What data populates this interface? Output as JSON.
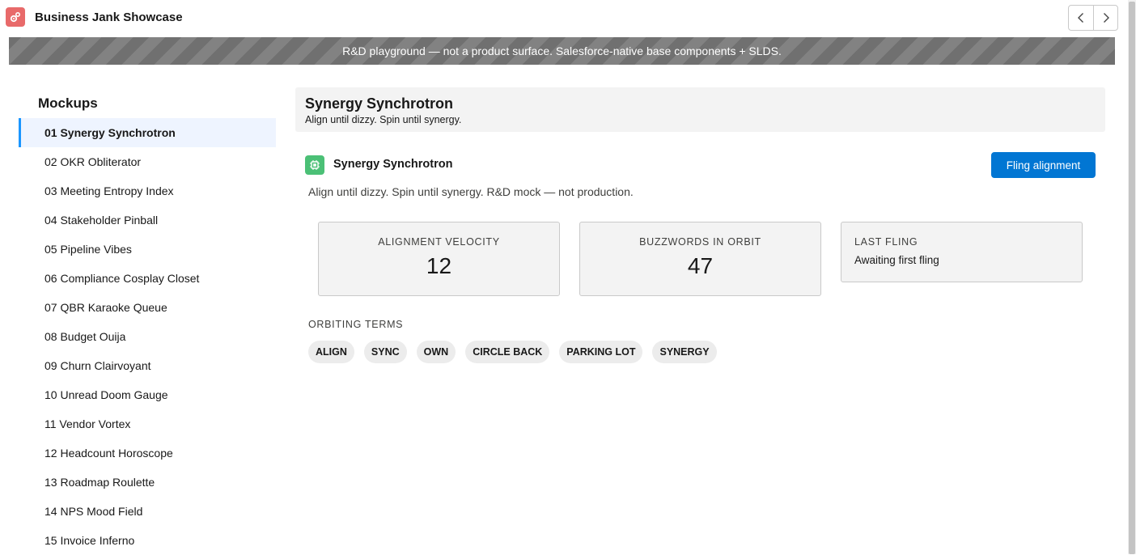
{
  "app": {
    "title": "Business Jank Showcase",
    "icon": "gears-icon",
    "accent": "#e86a6a"
  },
  "nav": {
    "prev_icon": "chevron-left-icon",
    "next_icon": "chevron-right-icon"
  },
  "banner": {
    "text": "R&D playground — not a product surface. Salesforce-native base components + SLDS."
  },
  "sidebar": {
    "heading": "Mockups",
    "active_index": 0,
    "items": [
      {
        "label": "01 Synergy Synchrotron"
      },
      {
        "label": "02 OKR Obliterator"
      },
      {
        "label": "03 Meeting Entropy Index"
      },
      {
        "label": "04 Stakeholder Pinball"
      },
      {
        "label": "05 Pipeline Vibes"
      },
      {
        "label": "06 Compliance Cosplay Closet"
      },
      {
        "label": "07 QBR Karaoke Queue"
      },
      {
        "label": "08 Budget Ouija"
      },
      {
        "label": "09 Churn Clairvoyant"
      },
      {
        "label": "10 Unread Doom Gauge"
      },
      {
        "label": "11 Vendor Vortex"
      },
      {
        "label": "12 Headcount Horoscope"
      },
      {
        "label": "13 Roadmap Roulette"
      },
      {
        "label": "14 NPS Mood Field"
      },
      {
        "label": "15 Invoice Inferno"
      }
    ]
  },
  "main": {
    "title": "Synergy Synchrotron",
    "subtitle": "Align until dizzy. Spin until synergy.",
    "card": {
      "icon": "chip-icon",
      "icon_color": "#4bc076",
      "title": "Synergy Synchrotron",
      "action_label": "Fling alignment",
      "action_color": "#0176d3",
      "description": "Align until dizzy. Spin until synergy. R&D mock — not production."
    },
    "metrics": [
      {
        "label": "ALIGNMENT VELOCITY",
        "value": "12"
      },
      {
        "label": "BUZZWORDS IN ORBIT",
        "value": "47"
      },
      {
        "label": "LAST FLING",
        "value": "Awaiting first fling"
      }
    ],
    "terms_heading": "ORBITING TERMS",
    "terms": [
      "ALIGN",
      "SYNC",
      "OWN",
      "CIRCLE BACK",
      "PARKING LOT",
      "SYNERGY"
    ]
  }
}
